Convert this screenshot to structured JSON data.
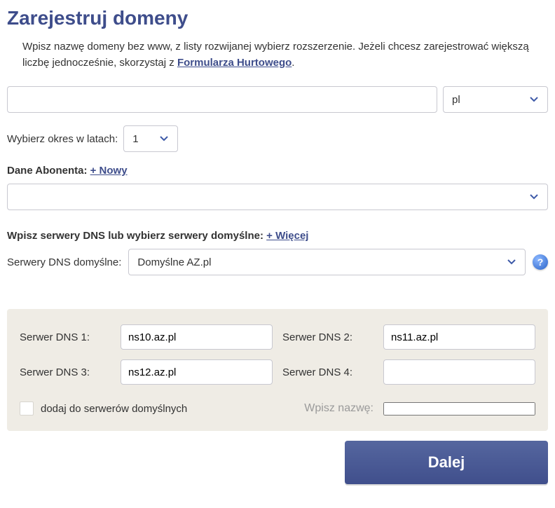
{
  "title": "Zarejestruj domeny",
  "intro": {
    "text_before_link": "Wpisz nazwę domeny bez www, z listy rozwijanej wybierz rozszerzenie. Jeżeli chcesz zarejestrować większą liczbę jednocześnie, skorzystaj z ",
    "link_text": "Formularza Hurtowego",
    "text_after_link": "."
  },
  "domain": {
    "value": "",
    "tld": "pl"
  },
  "period": {
    "label": "Wybierz okres w latach:",
    "value": "1"
  },
  "subscriber": {
    "label": "Dane Abonenta:",
    "new_label": "+ Nowy",
    "selected": ""
  },
  "dns_header": {
    "label": "Wpisz serwery DNS lub wybierz serwery domyślne:",
    "more_label": "+ Więcej"
  },
  "dns_default": {
    "label": "Serwery DNS domyślne:",
    "selected": "Domyślne AZ.pl"
  },
  "dns_servers": {
    "dns1": {
      "label": "Serwer DNS 1:",
      "value": "ns10.az.pl"
    },
    "dns2": {
      "label": "Serwer DNS 2:",
      "value": "ns11.az.pl"
    },
    "dns3": {
      "label": "Serwer DNS 3:",
      "value": "ns12.az.pl"
    },
    "dns4": {
      "label": "Serwer DNS 4:",
      "value": ""
    }
  },
  "add_default": {
    "checkbox_label": "dodaj do serwerów domyślnych",
    "name_label": "Wpisz nazwę:",
    "name_value": ""
  },
  "submit": {
    "label": "Dalej"
  }
}
